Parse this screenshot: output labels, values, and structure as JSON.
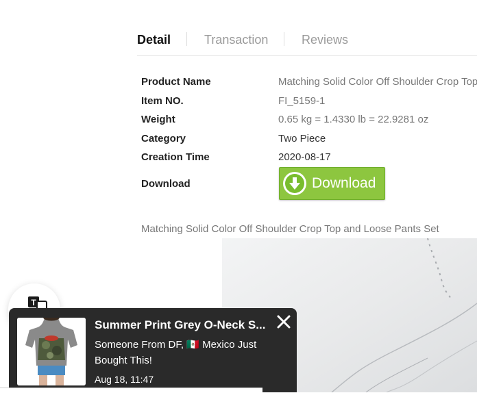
{
  "tabs": [
    {
      "label": "Detail",
      "active": true
    },
    {
      "label": "Transaction",
      "active": false
    },
    {
      "label": "Reviews",
      "active": false
    }
  ],
  "specs": {
    "product_name": {
      "label": "Product Name",
      "value": "Matching Solid Color Off Shoulder Crop Top and Loose Pants Set"
    },
    "item_no": {
      "label": "Item NO.",
      "value": "FI_5159-1"
    },
    "weight": {
      "label": "Weight",
      "value": "0.65 kg = 1.4330 lb = 22.9281 oz"
    },
    "category": {
      "label": "Category",
      "value": "Two Piece"
    },
    "creation_time": {
      "label": "Creation Time",
      "value": "2020-08-17"
    },
    "download": {
      "label": "Download",
      "button_label": "Download"
    }
  },
  "description": "Matching Solid Color Off Shoulder Crop Top and Loose Pants Set",
  "notification": {
    "title": "Summer Print Grey O-Neck S...",
    "message_prefix": "Someone From DF,",
    "flag": "🇲🇽",
    "message_suffix": "Mexico Just Bought This!",
    "time": "Aug 18, 11:47"
  },
  "icons": {
    "download": "download-arrow-icon",
    "translate": "translate-icon",
    "close": "close-icon"
  },
  "colors": {
    "download_green": "#8dc63f",
    "notification_bg": "#2a2a2a"
  }
}
